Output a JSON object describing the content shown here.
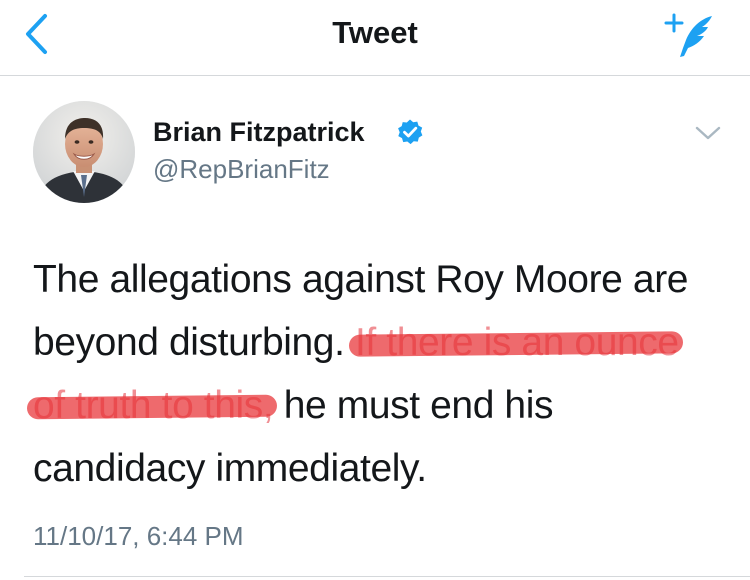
{
  "navbar": {
    "title": "Tweet",
    "back_icon": "chevron-left-icon",
    "compose_icon": "compose-tweet-icon"
  },
  "tweet": {
    "author": {
      "display_name": "Brian Fitzpatrick",
      "handle": "@RepBrianFitz",
      "verified": true
    },
    "text_lines": [
      [
        "The allegations against Roy Moore are"
      ],
      [
        "beyond disturbing. ",
        "If there is an ounce"
      ],
      [
        "of truth to this,",
        " he must end his"
      ],
      [
        "candidacy immediately."
      ]
    ],
    "timestamp": "11/10/17, 6:44 PM"
  },
  "colors": {
    "accent": "#1da1f2",
    "strike_highlight": "#e83034",
    "secondary_text": "#657786",
    "primary_text": "#14171a"
  }
}
